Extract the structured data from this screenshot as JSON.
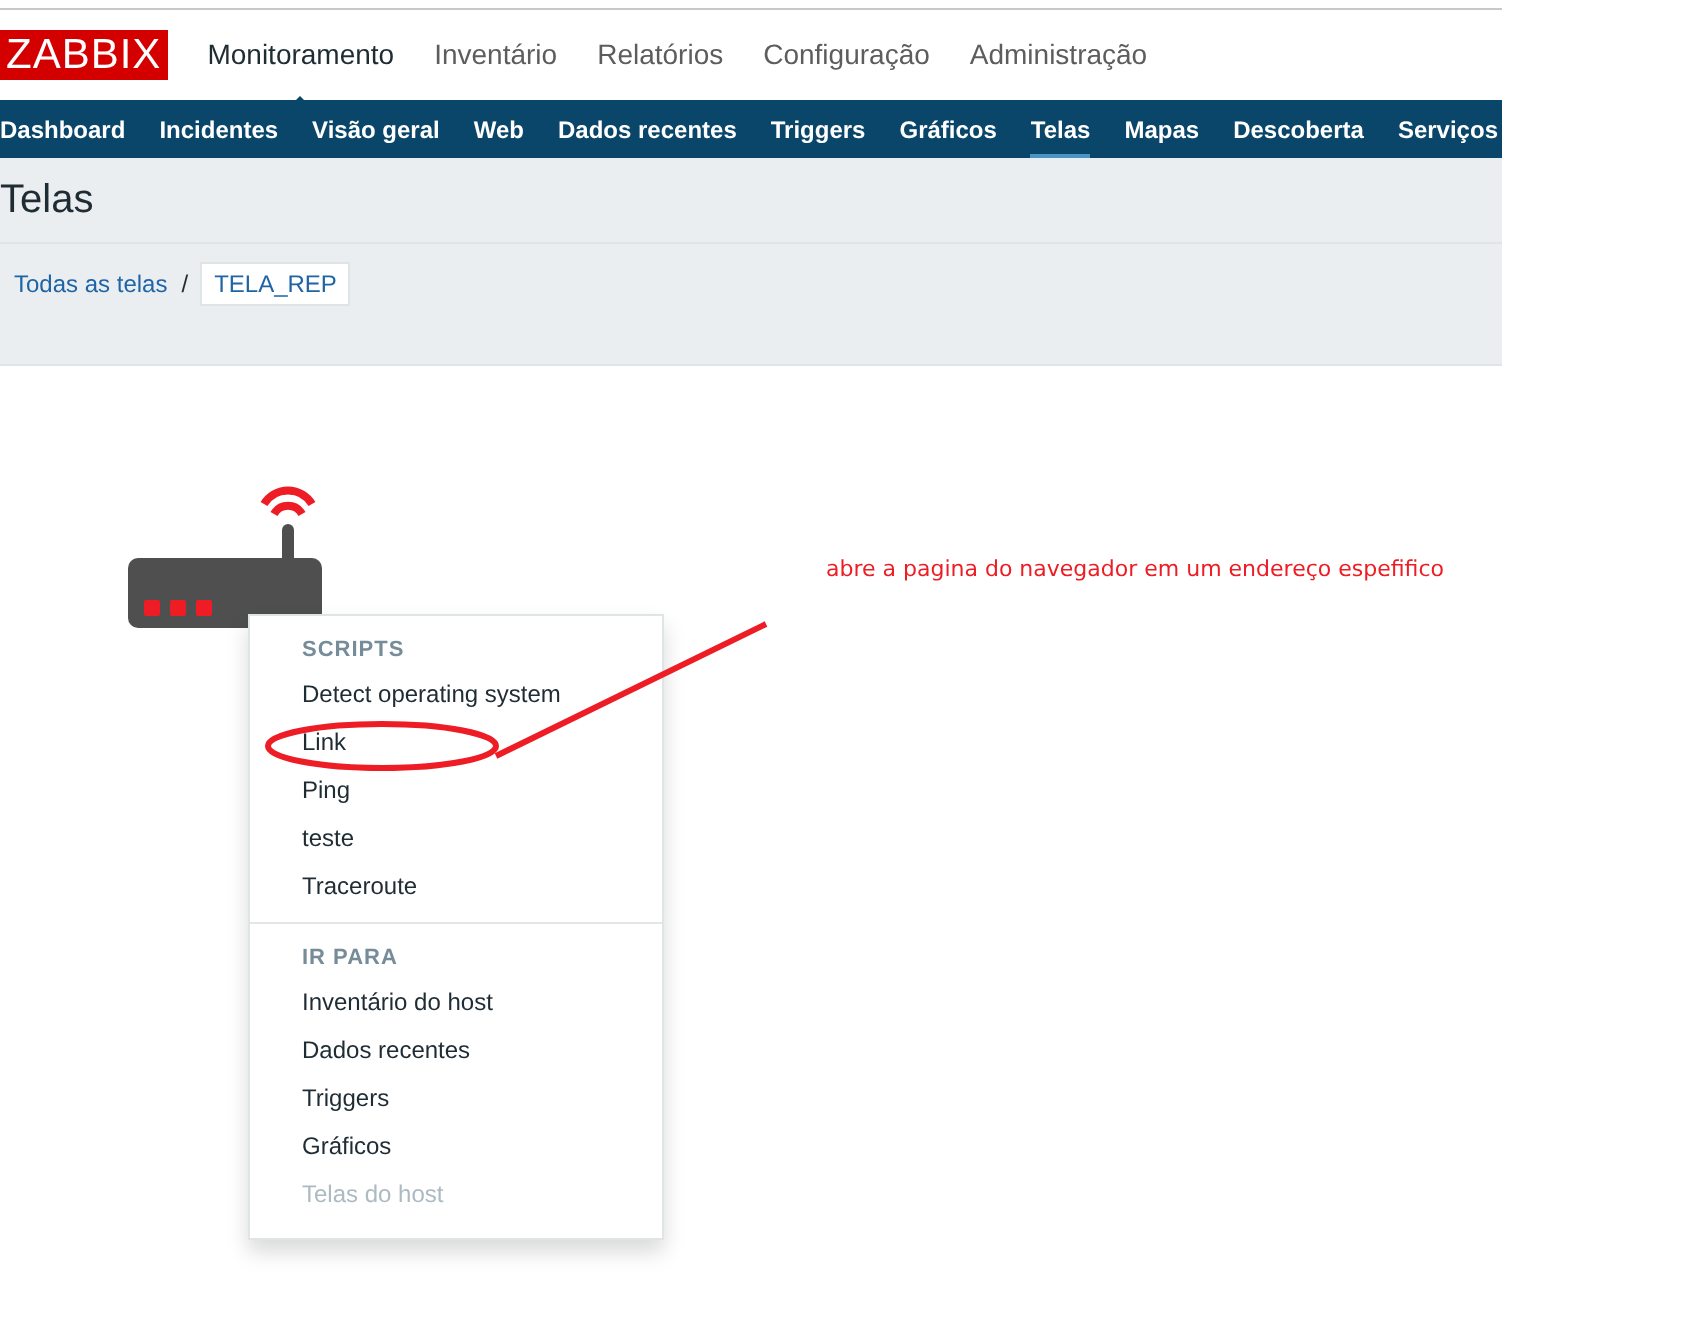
{
  "logo": "ZABBIX",
  "top_menu": [
    {
      "label": "Monitoramento",
      "selected": true
    },
    {
      "label": "Inventário",
      "selected": false
    },
    {
      "label": "Relatórios",
      "selected": false
    },
    {
      "label": "Configuração",
      "selected": false
    },
    {
      "label": "Administração",
      "selected": false
    }
  ],
  "sub_menu": [
    {
      "label": "Dashboard",
      "selected": false
    },
    {
      "label": "Incidentes",
      "selected": false
    },
    {
      "label": "Visão geral",
      "selected": false
    },
    {
      "label": "Web",
      "selected": false
    },
    {
      "label": "Dados recentes",
      "selected": false
    },
    {
      "label": "Triggers",
      "selected": false
    },
    {
      "label": "Gráficos",
      "selected": false
    },
    {
      "label": "Telas",
      "selected": true
    },
    {
      "label": "Mapas",
      "selected": false
    },
    {
      "label": "Descoberta",
      "selected": false
    },
    {
      "label": "Serviços",
      "selected": false
    }
  ],
  "page_title": "Telas",
  "breadcrumbs": [
    {
      "label": "Todas as telas",
      "selected": false
    },
    {
      "label": "TELA_REP",
      "selected": true
    }
  ],
  "breadcrumb_separator": "/",
  "context_menu": {
    "sections": [
      {
        "heading": "SCRIPTS",
        "items": [
          {
            "label": "Detect operating system",
            "disabled": false
          },
          {
            "label": "Link",
            "disabled": false
          },
          {
            "label": "Ping",
            "disabled": false
          },
          {
            "label": "teste",
            "disabled": false
          },
          {
            "label": "Traceroute",
            "disabled": false
          }
        ]
      },
      {
        "heading": "IR PARA",
        "items": [
          {
            "label": "Inventário do host",
            "disabled": false
          },
          {
            "label": "Dados recentes",
            "disabled": false
          },
          {
            "label": "Triggers",
            "disabled": false
          },
          {
            "label": "Gráficos",
            "disabled": false
          },
          {
            "label": "Telas do host",
            "disabled": true
          }
        ]
      }
    ]
  },
  "annotation": {
    "text": "abre a pagina do navegador em um endereço espefifico"
  }
}
